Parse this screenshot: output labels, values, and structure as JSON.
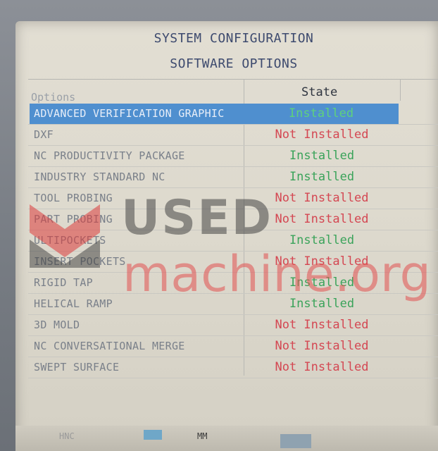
{
  "screen": {
    "title": "SYSTEM CONFIGURATION",
    "subtitle": "SOFTWARE OPTIONS"
  },
  "table": {
    "columns": [
      "Options",
      "State"
    ],
    "rows": [
      {
        "option": "ADVANCED VERIFICATION GRAPHIC",
        "state": "Installed",
        "selected": true
      },
      {
        "option": "DXF",
        "state": "Not Installed"
      },
      {
        "option": "NC PRODUCTIVITY PACKAGE",
        "state": "Installed"
      },
      {
        "option": "INDUSTRY STANDARD NC",
        "state": "Installed"
      },
      {
        "option": "TOOL PROBING",
        "state": "Not Installed"
      },
      {
        "option": "PART PROBING",
        "state": "Not Installed"
      },
      {
        "option": "ULTIPOCKETS",
        "state": "Installed"
      },
      {
        "option": "INSERT POCKETS",
        "state": "Not Installed"
      },
      {
        "option": "RIGID TAP",
        "state": "Installed"
      },
      {
        "option": "HELICAL RAMP",
        "state": "Installed"
      },
      {
        "option": "3D MOLD",
        "state": "Not Installed"
      },
      {
        "option": "NC CONVERSATIONAL MERGE",
        "state": "Not Installed"
      },
      {
        "option": "SWEPT SURFACE",
        "state": "Not Installed"
      }
    ]
  },
  "status_bar": {
    "mode": "HNC",
    "units": "MM"
  },
  "watermark": {
    "line1": "USED",
    "line2": "machine.org"
  },
  "colors": {
    "installed": "#3aa35a",
    "not_installed": "#d44752",
    "selection": "#4f8fcf",
    "title": "#3d4a6e"
  }
}
